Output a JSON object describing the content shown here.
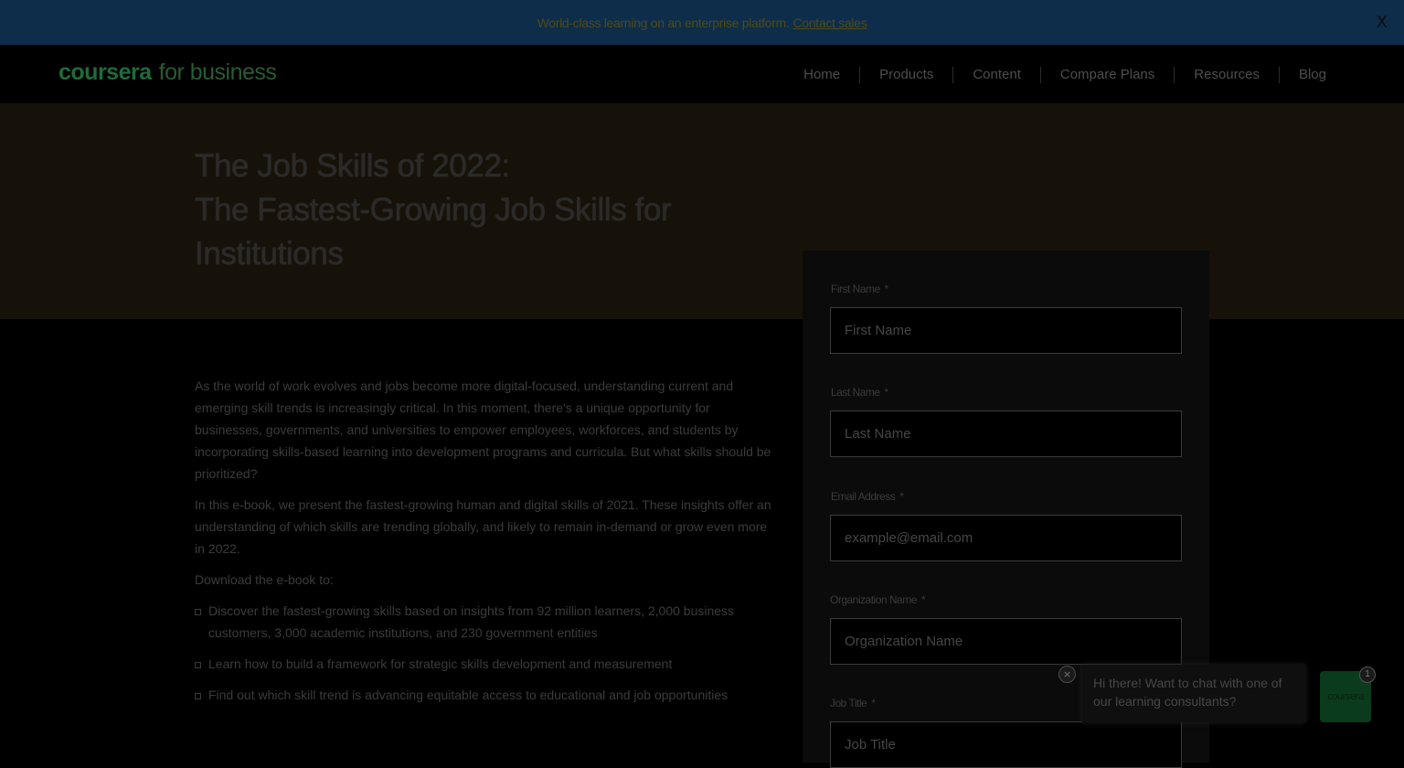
{
  "banner": {
    "text": "World-class learning on an enterprise platform.",
    "link": "Contact sales",
    "close": "X"
  },
  "nav": {
    "logo_brand": "coursera",
    "logo_suffix": "for business",
    "links": [
      "Home",
      "Products",
      "Content",
      "Compare Plans",
      "Resources",
      "Blog"
    ]
  },
  "hero": {
    "title_line1": "The Job Skills of 2022:",
    "title_line2": "The Fastest-Growing Job Skills for Institutions"
  },
  "content": {
    "paragraph1": "As the world of work evolves and jobs become more digital-focused, understanding current and emerging skill trends is increasingly critical. In this moment, there's a unique opportunity for businesses, governments, and universities to empower employees, workforces, and students by incorporating skills-based learning into development programs and curricula. But what skills should be prioritized?",
    "paragraph2": "In this e-book, we present the fastest-growing human and digital skills of 2021. These insights offer an understanding of which skills are trending globally, and likely to remain in-demand or grow even more in 2022.",
    "paragraph3": "Download the e-book to:",
    "bullets": [
      "Discover the fastest-growing skills based on insights from 92 million learners, 2,000 business customers, 3,000 academic institutions, and 230 government entities",
      "Learn how to build a framework for strategic skills development and measurement",
      "Find out which skill trend is advancing equitable access to educational and job opportunities"
    ]
  },
  "form": {
    "first_name_label": "First Name",
    "first_name_placeholder": "First Name",
    "last_name_label": "Last Name",
    "last_name_placeholder": "Last Name",
    "email_label": "Email Address",
    "email_placeholder": "example@email.com",
    "org_label": "Organization Name",
    "org_placeholder": "Organization Name",
    "job_label": "Job Title",
    "job_placeholder": "Job Title",
    "required_marker": "*"
  },
  "chat": {
    "message": "Hi there! Want to chat with one of our learning consultants?",
    "close": "×",
    "launcher_label": "coursera",
    "badge": "1"
  }
}
